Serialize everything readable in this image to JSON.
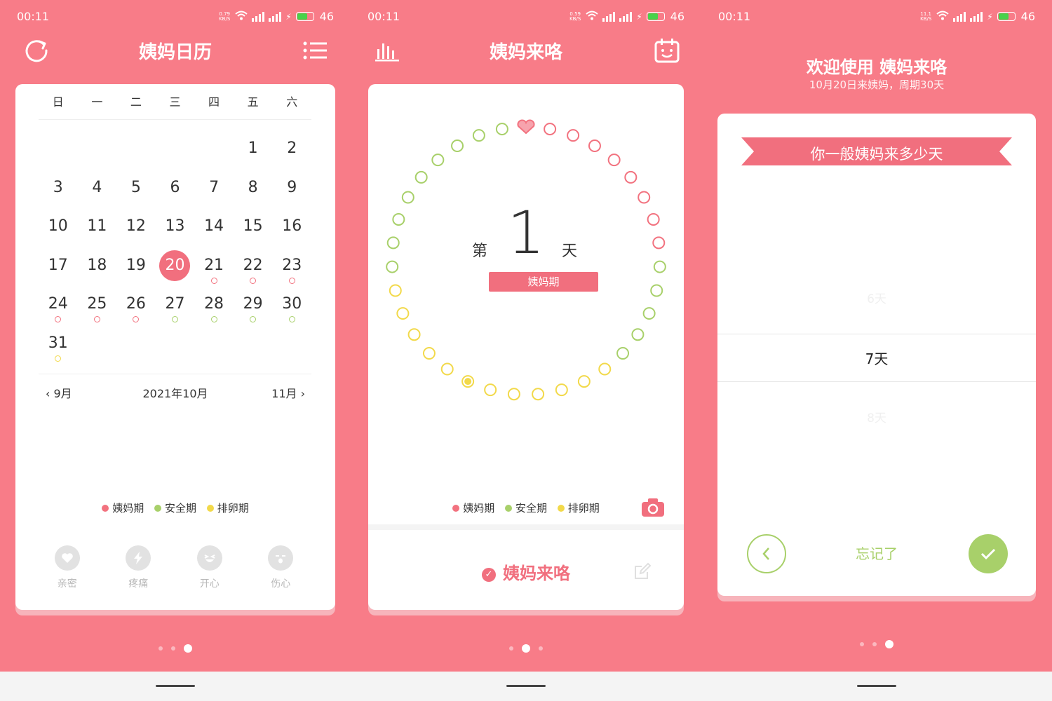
{
  "colors": {
    "brand": "#f87c88",
    "menstrual": "#f2727f",
    "safe": "#a8d06a",
    "ovulation": "#f2d94a"
  },
  "status": [
    {
      "time": "00:11",
      "speed": "0.79\nKB/S",
      "battery": "46"
    },
    {
      "time": "00:11",
      "speed": "0.59\nKB/S",
      "battery": "46"
    },
    {
      "time": "00:11",
      "speed": "11.1\nKB/S",
      "battery": "46"
    }
  ],
  "calendar_screen": {
    "title": "姨妈日历",
    "left_icon": "refresh-icon",
    "right_icon": "list-icon",
    "weekdays": [
      "日",
      "一",
      "二",
      "三",
      "四",
      "五",
      "六"
    ],
    "days": [
      {
        "n": "",
        "m": ""
      },
      {
        "n": "",
        "m": ""
      },
      {
        "n": "",
        "m": ""
      },
      {
        "n": "",
        "m": ""
      },
      {
        "n": "",
        "m": ""
      },
      {
        "n": "1",
        "m": ""
      },
      {
        "n": "2",
        "m": ""
      },
      {
        "n": "3",
        "m": ""
      },
      {
        "n": "4",
        "m": ""
      },
      {
        "n": "5",
        "m": ""
      },
      {
        "n": "6",
        "m": ""
      },
      {
        "n": "7",
        "m": ""
      },
      {
        "n": "8",
        "m": ""
      },
      {
        "n": "9",
        "m": ""
      },
      {
        "n": "10",
        "m": ""
      },
      {
        "n": "11",
        "m": ""
      },
      {
        "n": "12",
        "m": ""
      },
      {
        "n": "13",
        "m": ""
      },
      {
        "n": "14",
        "m": ""
      },
      {
        "n": "15",
        "m": ""
      },
      {
        "n": "16",
        "m": ""
      },
      {
        "n": "17",
        "m": ""
      },
      {
        "n": "18",
        "m": ""
      },
      {
        "n": "19",
        "m": ""
      },
      {
        "n": "20",
        "m": "",
        "today": true
      },
      {
        "n": "21",
        "m": "m"
      },
      {
        "n": "22",
        "m": "m"
      },
      {
        "n": "23",
        "m": "m"
      },
      {
        "n": "24",
        "m": "m"
      },
      {
        "n": "25",
        "m": "m"
      },
      {
        "n": "26",
        "m": "m"
      },
      {
        "n": "27",
        "m": "s"
      },
      {
        "n": "28",
        "m": "s"
      },
      {
        "n": "29",
        "m": "s"
      },
      {
        "n": "30",
        "m": "s"
      },
      {
        "n": "31",
        "m": "o"
      }
    ],
    "prev_month": "9月",
    "current_month": "2021年10月",
    "next_month": "11月",
    "legend": [
      "姨妈期",
      "安全期",
      "排卵期"
    ],
    "moods": [
      {
        "label": "亲密",
        "icon": "heart-icon"
      },
      {
        "label": "疼痛",
        "icon": "lightning-icon"
      },
      {
        "label": "开心",
        "icon": "laugh-face-icon"
      },
      {
        "label": "伤心",
        "icon": "cry-face-icon"
      }
    ]
  },
  "cycle_screen": {
    "title": "姨妈来咯",
    "left_icon": "stats-icon",
    "right_icon": "calendar-face-icon",
    "day_prefix": "第",
    "day_number": "1",
    "day_suffix": "天",
    "phase": "姨妈期",
    "cycle_dots": [
      "heart",
      "m",
      "m",
      "m",
      "m",
      "m",
      "m",
      "m",
      "m",
      "s",
      "s",
      "s",
      "s",
      "s",
      "o",
      "o",
      "o",
      "o",
      "o",
      "o",
      "current",
      "o",
      "o",
      "o",
      "o",
      "o",
      "s",
      "s",
      "s",
      "s",
      "s",
      "s",
      "s",
      "s",
      "s"
    ],
    "legend": [
      "姨妈期",
      "安全期",
      "排卵期"
    ],
    "action": "姨妈来咯"
  },
  "setup_screen": {
    "welcome": "欢迎使用 姨妈来咯",
    "subtitle": "10月20日来姨妈，周期30天",
    "question": "你一般姨妈来多少天",
    "options": [
      "6天",
      "7天",
      "8天"
    ],
    "selected": "7天",
    "forget": "忘记了"
  },
  "pager": [
    3,
    2,
    3
  ]
}
